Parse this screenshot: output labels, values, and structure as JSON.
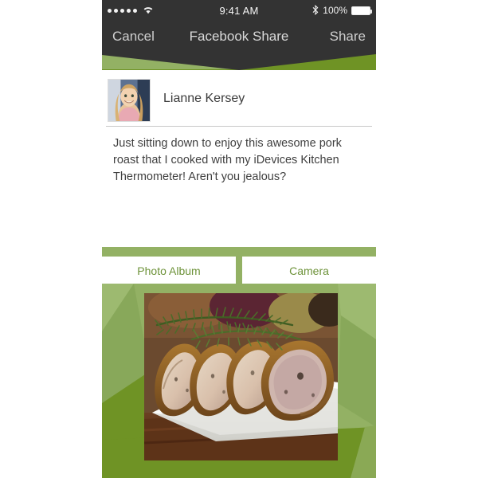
{
  "status_bar": {
    "signal_dots": 5,
    "wifi_icon": "wifi-icon",
    "time": "9:41 AM",
    "bluetooth_icon": "bluetooth-icon",
    "battery_percent": "100%",
    "battery_icon": "battery-full-icon"
  },
  "nav_bar": {
    "cancel_label": "Cancel",
    "title": "Facebook Share",
    "share_label": "Share"
  },
  "author": {
    "name": "Lianne Kersey",
    "avatar_alt": "avatar"
  },
  "post": {
    "message": "Just sitting down to enjoy this awesome pork roast that I cooked with my iDevices Kitchen Thermometer! Aren't you jealous?"
  },
  "tabs": [
    {
      "label": "Photo Album",
      "selected": true
    },
    {
      "label": "Camera",
      "selected": false
    }
  ],
  "photo": {
    "alt": "sliced pork roast with rosemary on a white plate"
  },
  "colors": {
    "bar_dark": "#333333",
    "green_light": "#93b164",
    "green_dark": "#6f9325",
    "tab_text_green": "#6d9239",
    "nav_text": "#cfcfcf",
    "body_text": "#3f3f3f"
  }
}
